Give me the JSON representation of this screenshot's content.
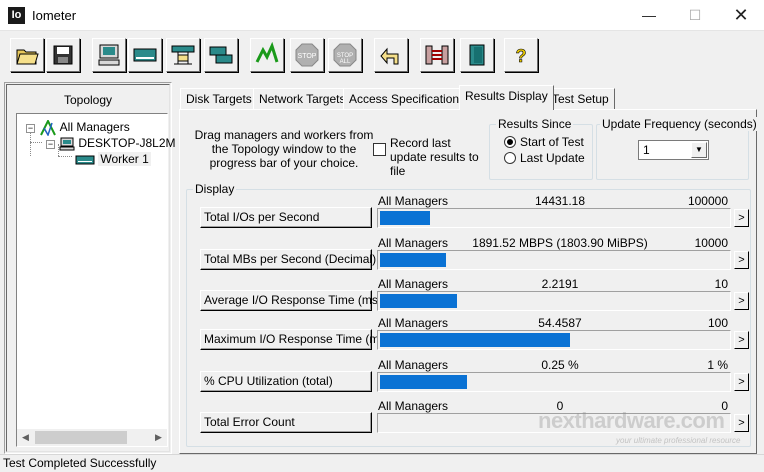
{
  "window": {
    "title": "Iometer",
    "app_icon_text": "Io"
  },
  "toolbar": {
    "buttons": [
      {
        "name": "open-icon"
      },
      {
        "name": "save-icon"
      },
      {
        "name": "new-manager-icon"
      },
      {
        "name": "new-disk-worker-icon"
      },
      {
        "name": "new-network-worker-icon"
      },
      {
        "name": "duplicate-worker-icon"
      },
      {
        "name": "start-icon"
      },
      {
        "name": "stop-icon",
        "label": "STOP"
      },
      {
        "name": "stop-all-icon",
        "label": "STOP ALL"
      },
      {
        "name": "reset-workers-icon"
      },
      {
        "name": "disconnect-icon"
      },
      {
        "name": "exit-icon"
      },
      {
        "name": "help-icon",
        "label": "?"
      }
    ]
  },
  "topology": {
    "header": "Topology",
    "tree": {
      "root": "All Managers",
      "manager": "DESKTOP-J8L2M",
      "worker": "Worker 1"
    }
  },
  "tabs": [
    {
      "label": "Disk Targets"
    },
    {
      "label": "Network Targets"
    },
    {
      "label": "Access Specifications"
    },
    {
      "label": "Results Display",
      "active": true
    },
    {
      "label": "Test Setup"
    }
  ],
  "results": {
    "drag_text": "Drag managers and workers from the Topology window to the progress bar of your choice.",
    "record_label": "Record last update results to file",
    "record_checked": false,
    "since_group": {
      "legend": "Results Since",
      "options": [
        "Start of Test",
        "Last Update"
      ],
      "selected": "Start of Test"
    },
    "update_frequency": {
      "legend": "Update Frequency (seconds)",
      "value": "1"
    },
    "display_legend": "Display",
    "metrics": [
      {
        "button": "Total I/Os per Second",
        "source": "All Managers",
        "value": "14431.18",
        "max": "100000",
        "fill": 0.1443
      },
      {
        "button": "Total MBs per Second (Decimal)",
        "source": "All Managers",
        "value": "1891.52 MBPS (1803.90 MiBPS)",
        "max": "10000",
        "fill": 0.1892
      },
      {
        "button": "Average I/O Response Time (ms)",
        "source": "All Managers",
        "value": "2.2191",
        "max": "10",
        "fill": 0.2219
      },
      {
        "button": "Maximum I/O Response Time (ms)",
        "source": "All Managers",
        "value": "54.4587",
        "max": "100",
        "fill": 0.5446
      },
      {
        "button": "% CPU Utilization (total)",
        "source": "All Managers",
        "value": "0.25 %",
        "max": "1 %",
        "fill": 0.25
      },
      {
        "button": "Total Error Count",
        "source": "All Managers",
        "value": "0",
        "max": "0",
        "fill": 0
      }
    ],
    "arrow_label": ">"
  },
  "watermark": {
    "main": "nexthardware.com",
    "sub": "your ultimate professional resource"
  },
  "status": {
    "text": "Test Completed Successfully"
  },
  "colors": {
    "bar_fill": "#0a72d4",
    "background": "#f0f0f0"
  }
}
